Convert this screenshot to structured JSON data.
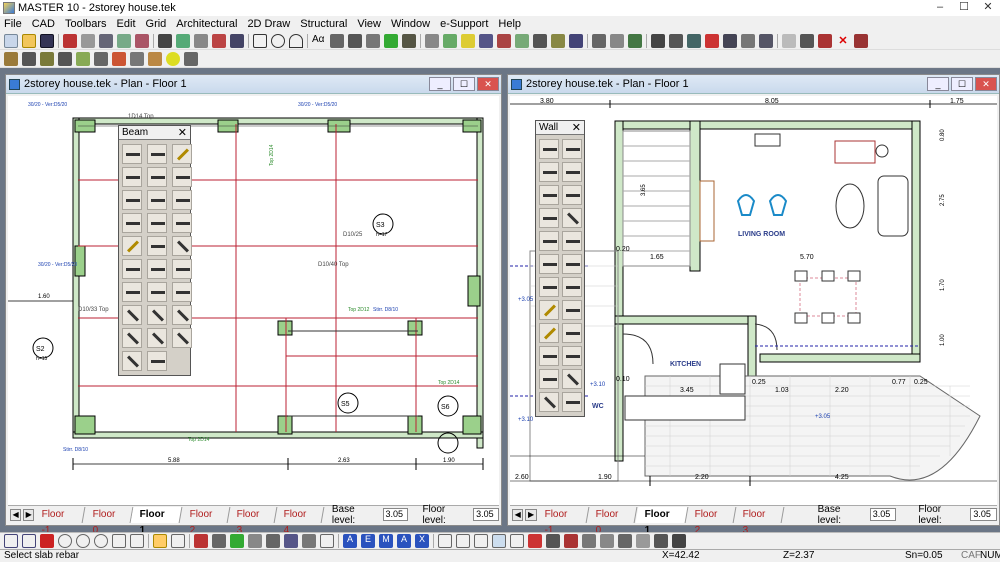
{
  "app": {
    "title": "MASTER 10 - 2storey house.tek",
    "controls": {
      "minimize": "–",
      "maximize": "☐",
      "close": "✕"
    }
  },
  "menu": [
    "File",
    "CAD",
    "Toolbars",
    "Edit",
    "Grid",
    "Architectural",
    "2D Draw",
    "Structural",
    "View",
    "Window",
    "e-Support",
    "Help"
  ],
  "windows": {
    "left": {
      "title": "2storey house.tek - Plan - Floor 1",
      "palette_title": "Beam",
      "floors": [
        "Floor -1",
        "Floor 0",
        "Floor 1",
        "Floor 2",
        "Floor 3",
        "Floor 4"
      ],
      "active_floor": "Floor 1",
      "base_level_label": "Base level:",
      "base_level_value": "3.05",
      "floor_level_label": "Floor level:",
      "floor_level_value": "3.05",
      "plan_labels": {
        "room_s2": "S2",
        "room_s3": "S3",
        "room_s5": "S5",
        "room_s6": "S6",
        "h15": "h=15",
        "h17": "h=17",
        "dim1": "1.60",
        "dim2": "5.88",
        "dim3": "2.63",
        "dim4": "1.90",
        "beam1": "D10/25",
        "beam2": "D10/40 Top",
        "beam3": "D10/33 Top",
        "beam4": "1D14 Top"
      }
    },
    "right": {
      "title": "2storey house.tek - Plan - Floor 1",
      "palette_title": "Wall",
      "floors": [
        "Floor -1",
        "Floor 0",
        "Floor 1",
        "Floor 2",
        "Floor 3"
      ],
      "active_floor": "Floor 1",
      "base_level_label": "Base level:",
      "base_level_value": "3.05",
      "floor_level_label": "Floor level:",
      "floor_level_value": "3.05",
      "plan_labels": {
        "top_dim1": "3.80",
        "top_dim2": "8.05",
        "top_dim3": "1.75",
        "living_room": "LIVING ROOM",
        "kitchen": "KITCHEN",
        "wc": "WC",
        "dim_570": "5.70",
        "dim_345": "3.45",
        "dim_103": "1.03",
        "dim_220": "2.20",
        "dim_077": "0.77",
        "dim_025a": "0.25",
        "dim_025b": "0.25",
        "dim_165": "1.65",
        "dim_020": "0.20",
        "dim_010": "0.10",
        "dim_260": "2.60",
        "dim_190": "1.90",
        "dim_220b": "2.20",
        "dim_425": "4.25",
        "dim_365": "3.65",
        "dim_080": "0.80",
        "dim_275": "2.75",
        "dim_170": "1.70",
        "dim_100": "1.00",
        "lvl1": "+3.05",
        "lvl2": "+3.10",
        "lvl3": "+3.10",
        "lvl4": "+3.05"
      }
    }
  },
  "status": {
    "message": "Select slab rebar",
    "x": "X=42.42",
    "z": "Z=2.37",
    "sn": "Sn=0.05",
    "caf": "CAF",
    "num": "NUM"
  }
}
